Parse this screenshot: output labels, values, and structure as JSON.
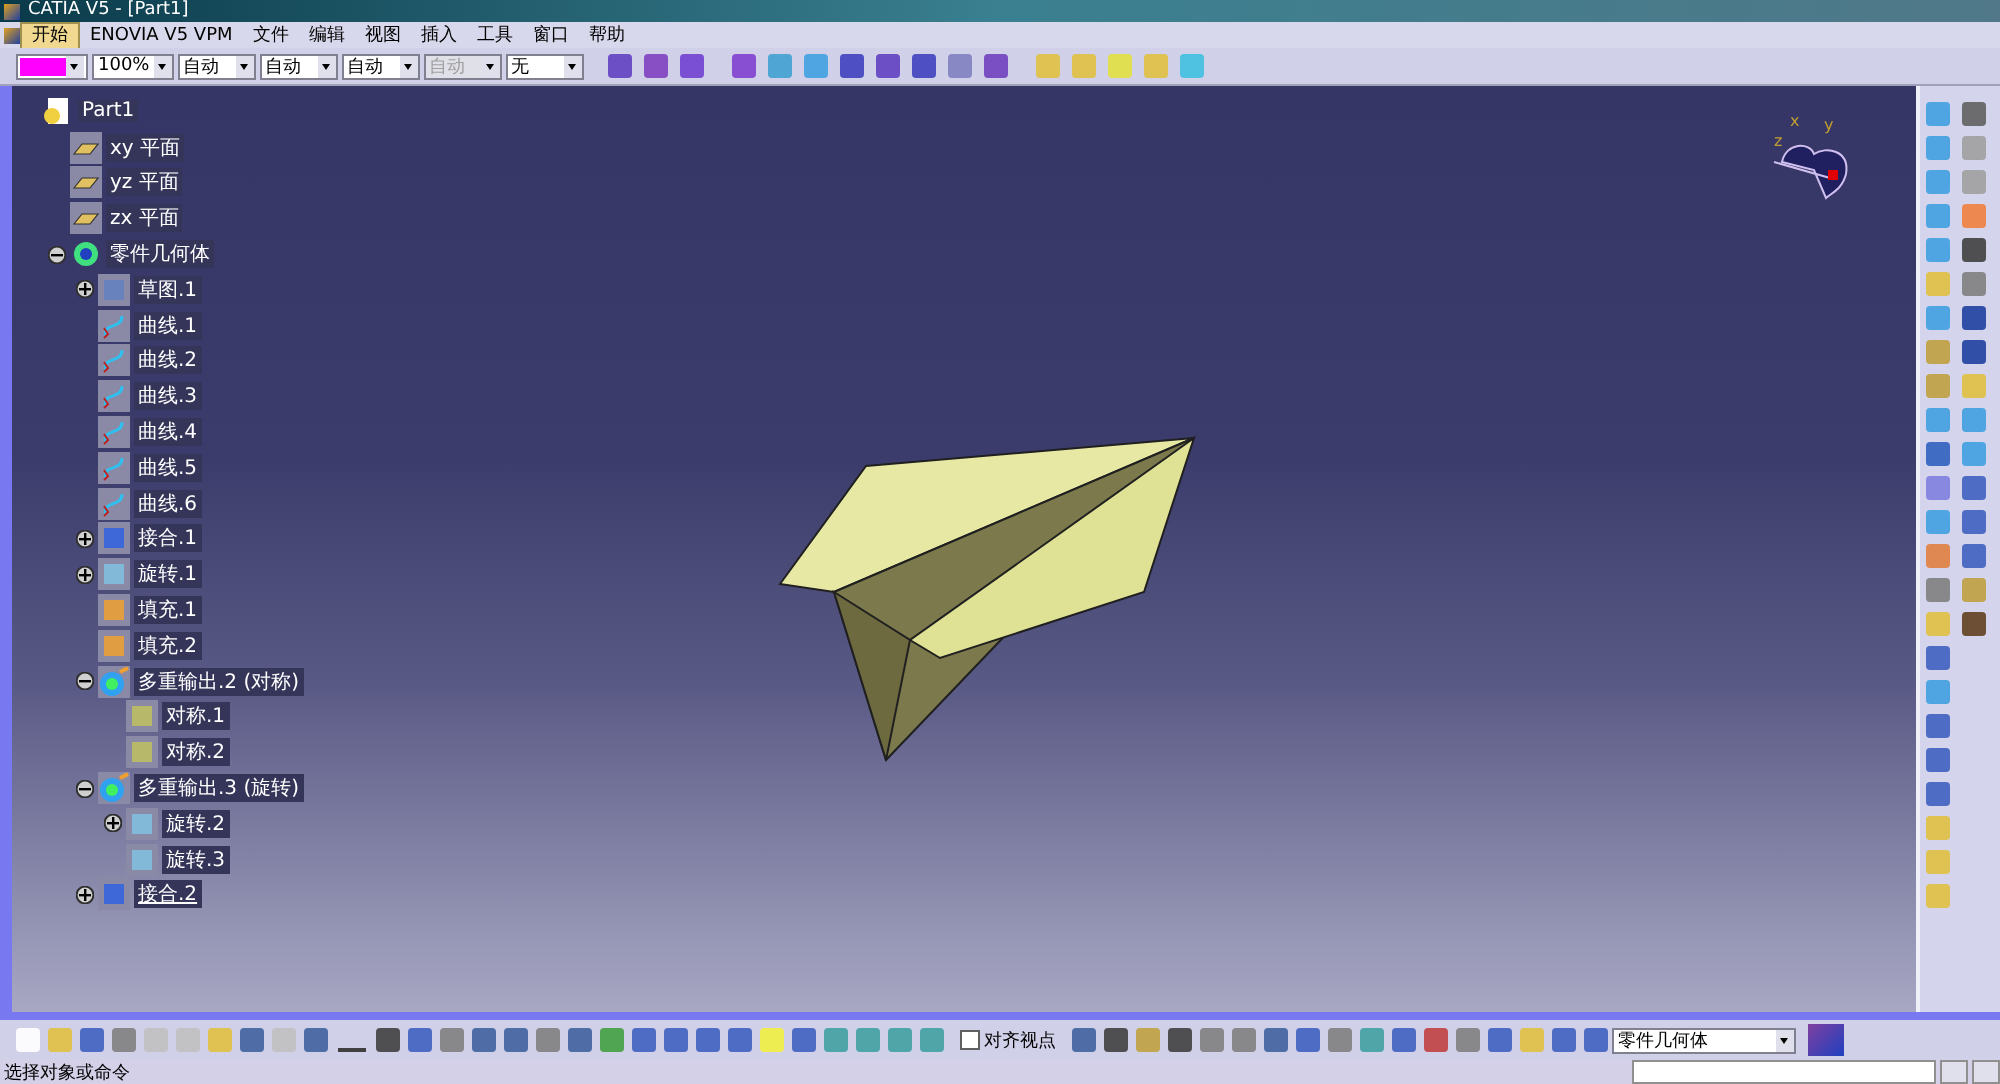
{
  "window": {
    "title": "CATIA V5 - [Part1]"
  },
  "menu": [
    {
      "label": "开始",
      "selected": true
    },
    {
      "label": "ENOVIA V5 VPM",
      "selected": false
    },
    {
      "label": "文件",
      "selected": false
    },
    {
      "label": "编辑",
      "selected": false
    },
    {
      "label": "视图",
      "selected": false
    },
    {
      "label": "插入",
      "selected": false
    },
    {
      "label": "工具",
      "selected": false
    },
    {
      "label": "窗口",
      "selected": false
    },
    {
      "label": "帮助",
      "selected": false
    }
  ],
  "properties_bar": {
    "color": "#ff00ff",
    "combos": [
      {
        "value": "100%",
        "disabled": false
      },
      {
        "value": "自动",
        "disabled": false
      },
      {
        "value": "自动",
        "disabled": false
      },
      {
        "value": "自动",
        "disabled": false
      },
      {
        "value": "自动",
        "disabled": true
      },
      {
        "value": "无",
        "disabled": false
      }
    ]
  },
  "tree": [
    {
      "label": "Part1",
      "kind": "part",
      "children": [
        {
          "label": "xy 平面",
          "kind": "plane"
        },
        {
          "label": "yz 平面",
          "kind": "plane"
        },
        {
          "label": "zx 平面",
          "kind": "plane"
        },
        {
          "label": "零件几何体",
          "kind": "body",
          "expanded": true,
          "children": [
            {
              "label": "草图.1",
              "kind": "sketch",
              "expanded": false
            },
            {
              "label": "曲线.1",
              "kind": "curve"
            },
            {
              "label": "曲线.2",
              "kind": "curve"
            },
            {
              "label": "曲线.3",
              "kind": "curve"
            },
            {
              "label": "曲线.4",
              "kind": "curve"
            },
            {
              "label": "曲线.5",
              "kind": "curve"
            },
            {
              "label": "曲线.6",
              "kind": "curve"
            },
            {
              "label": "接合.1",
              "kind": "join",
              "expanded": false
            },
            {
              "label": "旋转.1",
              "kind": "revolve",
              "expanded": false
            },
            {
              "label": "填充.1",
              "kind": "fill"
            },
            {
              "label": "填充.2",
              "kind": "fill"
            },
            {
              "label": "多重输出.2 (对称)",
              "kind": "multi",
              "expanded": true,
              "children": [
                {
                  "label": "对称.1",
                  "kind": "symmetry"
                },
                {
                  "label": "对称.2",
                  "kind": "symmetry"
                }
              ]
            },
            {
              "label": "多重输出.3 (旋转)",
              "kind": "multi",
              "expanded": true,
              "children": [
                {
                  "label": "旋转.2",
                  "kind": "revolve",
                  "expanded": false
                },
                {
                  "label": "旋转.3",
                  "kind": "revolve"
                }
              ]
            },
            {
              "label": "接合.2",
              "kind": "join",
              "expanded": false,
              "current": true
            }
          ]
        }
      ]
    }
  ],
  "compass": {
    "axes": [
      "x",
      "y",
      "z"
    ]
  },
  "bottom_toolbar": {
    "align_view": {
      "label": "对齐视点",
      "checked": false
    },
    "body_combo": {
      "value": "零件几何体"
    }
  },
  "status_bar": {
    "message": "选择对象或命令"
  }
}
